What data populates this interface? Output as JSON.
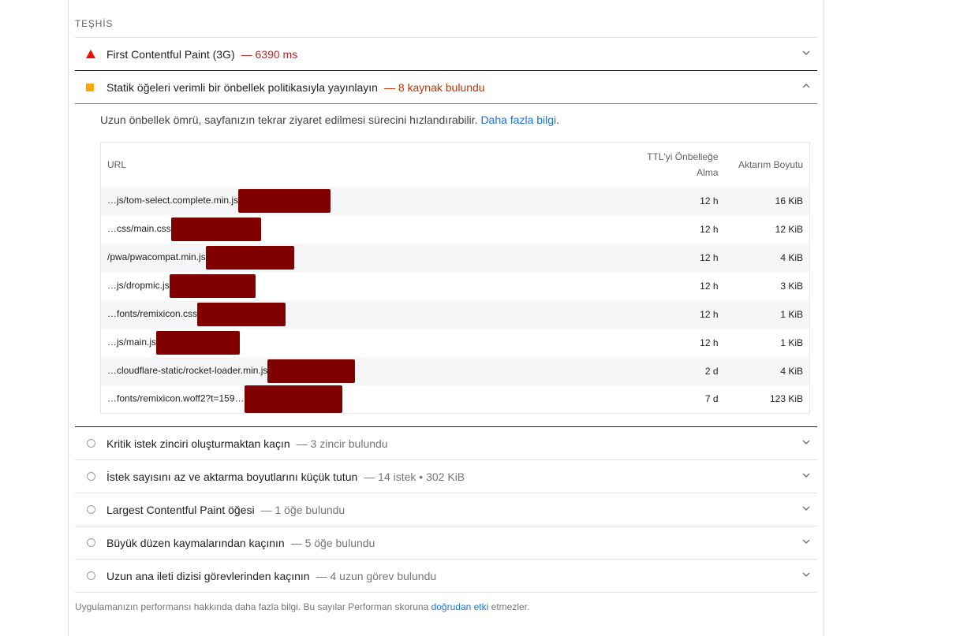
{
  "group_title": "TEŞHİS",
  "fcp": {
    "title": "First Contentful Paint (3G)",
    "display": "— 6390 ms"
  },
  "cache": {
    "title": "Statik öğeleri verimli bir önbellek politikasıyla yayınlayın",
    "display": "— 8 kaynak bulundu",
    "description": "Uzun önbellek ömrü, sayfanızın tekrar ziyaret edilmesi sürecini hızlandırabilir.",
    "link": "Daha fazla bilgi",
    "period": ".",
    "columns": {
      "url": "URL",
      "ttl": "TTL'yi Önbelleğe Alma",
      "size": "Aktarım Boyutu"
    },
    "rows": [
      {
        "url": "…js/tom-select.complete.min.js",
        "ttl": "12 h",
        "size": "16 KiB"
      },
      {
        "url": "…css/main.css",
        "ttl": "12 h",
        "size": "12 KiB"
      },
      {
        "url": "/pwa/pwacompat.min.js",
        "ttl": "12 h",
        "size": "4 KiB"
      },
      {
        "url": "…js/dropmic.js",
        "ttl": "12 h",
        "size": "3 KiB"
      },
      {
        "url": "…fonts/remixicon.css",
        "ttl": "12 h",
        "size": "1 KiB"
      },
      {
        "url": "…js/main.js",
        "ttl": "12 h",
        "size": "1 KiB"
      },
      {
        "url": "…cloudflare-static/rocket-loader.min.js",
        "ttl": "2 d",
        "size": "4 KiB"
      },
      {
        "url": "…fonts/remixicon.woff2?t=159…",
        "ttl": "7 d",
        "size": "123 KiB"
      }
    ]
  },
  "audits": [
    {
      "title": "Kritik istek zinciri oluşturmaktan kaçın",
      "display": "— 3 zincir bulundu"
    },
    {
      "title": "İstek sayısını az ve aktarma boyutlarını küçük tutun",
      "display": "— 14 istek • 302 KiB"
    },
    {
      "title": "Largest Contentful Paint öğesi",
      "display": "— 1 öğe bulundu"
    },
    {
      "title": "Büyük düzen kaymalarından kaçının",
      "display": "— 5 öğe bulundu"
    },
    {
      "title": "Uzun ana ileti dizisi görevlerinden kaçının",
      "display": "— 4 uzun görev bulundu"
    }
  ],
  "footer": {
    "text": "Uygulamanızın performansı hakkında daha fazla bilgi. Bu sayılar Performan skoruna ",
    "link": "doğrudan etki",
    "text2": " etmezler."
  },
  "colors": {
    "fail": "#eb0f00",
    "average": "#ffa400",
    "link": "#1a73e8",
    "redaction": "#800000"
  }
}
